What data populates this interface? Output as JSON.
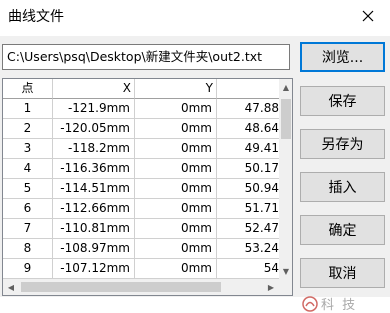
{
  "window": {
    "title": "曲线文件"
  },
  "file": {
    "path": "C:\\Users\\psq\\Desktop\\新建文件夹\\out2.txt"
  },
  "buttons": {
    "browse": "浏览...",
    "save": "保存",
    "save_as": "另存为",
    "insert": "插入",
    "ok": "确定",
    "cancel": "取消"
  },
  "table": {
    "columns": [
      "点",
      "X",
      "Y",
      ""
    ],
    "rows": [
      [
        "1",
        "-121.9mm",
        "0mm",
        "47.88"
      ],
      [
        "2",
        "-120.05mm",
        "0mm",
        "48.64"
      ],
      [
        "3",
        "-118.2mm",
        "0mm",
        "49.41"
      ],
      [
        "4",
        "-116.36mm",
        "0mm",
        "50.17"
      ],
      [
        "5",
        "-114.51mm",
        "0mm",
        "50.94"
      ],
      [
        "6",
        "-112.66mm",
        "0mm",
        "51.71"
      ],
      [
        "7",
        "-110.81mm",
        "0mm",
        "52.47"
      ],
      [
        "8",
        "-108.97mm",
        "0mm",
        "53.24"
      ],
      [
        "9",
        "-107.12mm",
        "0mm",
        "54"
      ]
    ]
  },
  "watermark": {
    "text": "科 技"
  },
  "colors": {
    "accent": "#0078d7",
    "client_bg": "#f0f0f0",
    "button_bg": "#e1e1e1"
  }
}
